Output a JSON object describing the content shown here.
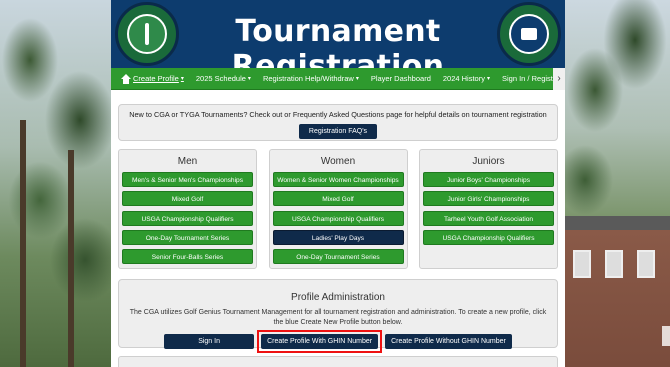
{
  "header": {
    "title": "Tournament Registration",
    "left_logo_icon": "cga-logo-icon",
    "right_logo_icon": "tygha-logo-icon"
  },
  "nav": {
    "items": [
      {
        "label": "Create Profile",
        "dropdown": true
      },
      {
        "label": "2025 Schedule",
        "dropdown": true
      },
      {
        "label": "Registration Help/Withdraw",
        "dropdown": true
      },
      {
        "label": "Player Dashboard",
        "dropdown": false
      },
      {
        "label": "2024 History",
        "dropdown": true
      },
      {
        "label": "Sign In / Register",
        "dropdown": false
      }
    ],
    "next_arrow": "›"
  },
  "intro": {
    "text": "New to CGA or TYGA Tournaments? Check out or Frequently Asked Questions page for helpful details on tournament registration",
    "button": "Registration FAQ's"
  },
  "columns": [
    {
      "title": "Men",
      "buttons": [
        "Men's & Senior Men's Championships",
        "Mixed Golf",
        "USGA Championship Qualifiers",
        "One-Day Tournament Series",
        "Senior Four-Balls Series"
      ]
    },
    {
      "title": "Women",
      "buttons": [
        "Women & Senior Women Championships",
        "Mixed Golf",
        "USGA Championship Qualifiers",
        "Ladies' Play Days",
        "One-Day Tournament Series"
      ]
    },
    {
      "title": "Juniors",
      "buttons": [
        "Junior Boys' Championships",
        "Junior Girls' Championships",
        "Tarheel Youth Golf Association",
        "USGA Championship Qualifiers"
      ]
    }
  ],
  "profile": {
    "title": "Profile Administration",
    "description": "The CGA utilizes Golf Genius Tournament Management for all tournament registration and administration. To create a new profile, click the blue Create New Profile button below.",
    "sign_in": "Sign In",
    "create_with_ghin": "Create Profile With GHIN Number",
    "create_without_ghin": "Create Profile Without GHIN Number"
  },
  "colors": {
    "header_bg": "#0d3c6e",
    "nav_green": "#2e9a2e",
    "dark_button": "#0f2a4a",
    "highlight": "#ee1111"
  }
}
